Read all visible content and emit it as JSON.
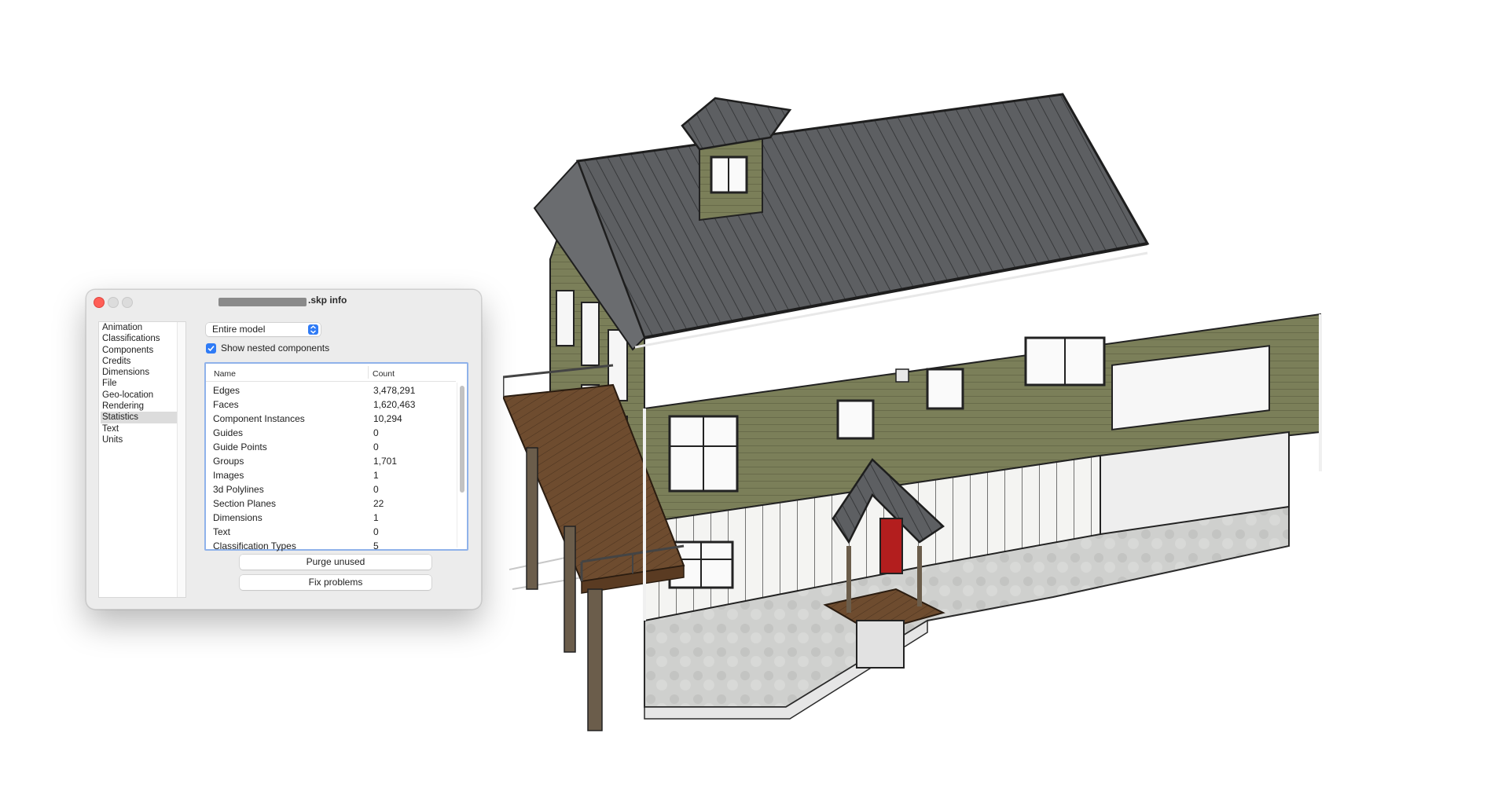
{
  "window": {
    "title": ".skp info",
    "sidebar_items": [
      "Animation",
      "Classifications",
      "Components",
      "Credits",
      "Dimensions",
      "File",
      "Geo-location",
      "Rendering",
      "Statistics",
      "Text",
      "Units"
    ],
    "selected_item": "Statistics",
    "scope_select": "Entire model",
    "show_nested_label": "Show nested components",
    "show_nested_checked": true,
    "table": {
      "col_name": "Name",
      "col_count": "Count",
      "rows": [
        {
          "name": "Edges",
          "count": "3,478,291"
        },
        {
          "name": "Faces",
          "count": "1,620,463"
        },
        {
          "name": "Component Instances",
          "count": "10,294"
        },
        {
          "name": "Guides",
          "count": "0"
        },
        {
          "name": "Guide Points",
          "count": "0"
        },
        {
          "name": "Groups",
          "count": "1,701"
        },
        {
          "name": "Images",
          "count": "1"
        },
        {
          "name": "3d Polylines",
          "count": "0"
        },
        {
          "name": "Section Planes",
          "count": "22"
        },
        {
          "name": "Dimensions",
          "count": "1"
        },
        {
          "name": "Text",
          "count": "0"
        },
        {
          "name": "Classification Types",
          "count": "5"
        }
      ]
    },
    "purge_label": "Purge unused",
    "fix_label": "Fix problems"
  },
  "colors": {
    "accent": "#2f7bf6",
    "close": "#ff5f57",
    "siding": "#7a7d58",
    "roof": "#5c5e60",
    "deck": "#6b4a2e",
    "door": "#b31e1e"
  }
}
